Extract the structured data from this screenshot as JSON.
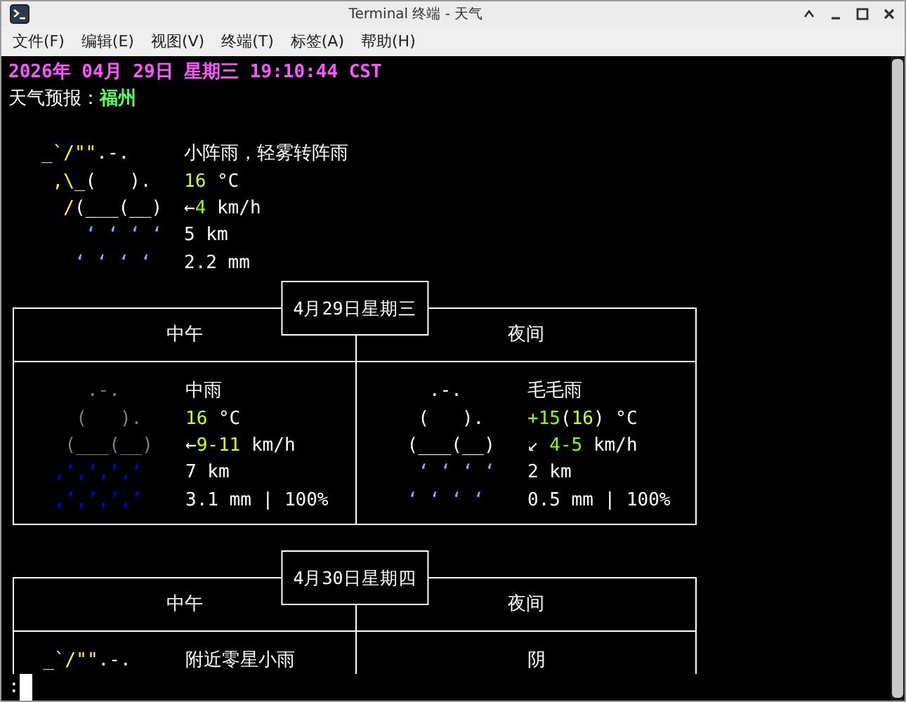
{
  "window": {
    "title": "Terminal 终端 - 天气"
  },
  "menu": [
    "文件(F)",
    "编辑(E)",
    "视图(V)",
    "终端(T)",
    "标签(A)",
    "帮助(H)"
  ],
  "terminal": {
    "header": {
      "bold": true,
      "segments": [
        {
          "text": "2026年 04月 29日 星期三 19:10:44 CST",
          "color": "#ff55ff"
        }
      ]
    },
    "title_line": [
      {
        "text": "天气预报：",
        "color": "#ffffff"
      },
      {
        "text": "福州",
        "color": "#55ff55"
      }
    ],
    "current": {
      "art": [
        [
          {
            "text": "   _`/\"\"",
            "color": "#ffff00"
          },
          {
            "text": ".-.",
            "color": "#ffffff"
          }
        ],
        [
          {
            "text": "    ,\\_",
            "color": "#ffff00"
          },
          {
            "text": "(   ).",
            "color": "#ffffff"
          }
        ],
        [
          {
            "text": "     /",
            "color": "#ffff00"
          },
          {
            "text": "(___(__)",
            "color": "#ffffff"
          }
        ],
        [
          {
            "text": "       ‘ ‘ ‘ ‘",
            "color": "#87afff"
          }
        ],
        [
          {
            "text": "      ‘ ‘ ‘ ‘",
            "color": "#87afff"
          }
        ]
      ],
      "info": [
        [
          {
            "text": "小阵雨，轻雾转阵雨",
            "color": "#ffffff"
          }
        ],
        [
          {
            "text": "16",
            "color": "#d7ff00"
          },
          {
            "text": " °C",
            "color": "#ffffff"
          }
        ],
        [
          {
            "text": "←",
            "color": "#ffffff"
          },
          {
            "text": "4",
            "color": "#87ff00"
          },
          {
            "text": " km/h",
            "color": "#ffffff"
          }
        ],
        [
          {
            "text": "5 km",
            "color": "#ffffff"
          }
        ],
        [
          {
            "text": "2.2 mm",
            "color": "#ffffff"
          }
        ]
      ]
    },
    "days": [
      {
        "date": "4月29日星期三",
        "periods": [
          {
            "label": "中午",
            "art": [
              [
                {
                  "text": "      .-.",
                  "color": "#808080"
                }
              ],
              [
                {
                  "text": "     (   ).",
                  "color": "#808080"
                }
              ],
              [
                {
                  "text": "    (___(__)",
                  "color": "#808080"
                }
              ],
              [
                {
                  "text": "   ‚‘‚‘‚‘‚‘",
                  "color": "#0000ff"
                }
              ],
              [
                {
                  "text": "   ‚’‚’‚’‚’",
                  "color": "#0000ff"
                }
              ]
            ],
            "info": [
              [
                {
                  "text": "中雨",
                  "color": "#ffffff"
                }
              ],
              [
                {
                  "text": "16",
                  "color": "#d7ff00"
                },
                {
                  "text": " °C",
                  "color": "#ffffff"
                }
              ],
              [
                {
                  "text": "←",
                  "color": "#ffffff"
                },
                {
                  "text": "9-11",
                  "color": "#d7ff00"
                },
                {
                  "text": " km/h",
                  "color": "#ffffff"
                }
              ],
              [
                {
                  "text": "7 km",
                  "color": "#ffffff"
                }
              ],
              [
                {
                  "text": "3.1 mm | 100%",
                  "color": "#ffffff"
                }
              ]
            ]
          },
          {
            "label": "夜间",
            "art": [
              [
                {
                  "text": "      .-.",
                  "color": "#ffffff"
                }
              ],
              [
                {
                  "text": "     (   ).",
                  "color": "#ffffff"
                }
              ],
              [
                {
                  "text": "    (___(__)",
                  "color": "#ffffff"
                }
              ],
              [
                {
                  "text": "     ‘ ‘ ‘ ‘",
                  "color": "#87afff"
                }
              ],
              [
                {
                  "text": "    ‘ ‘ ‘ ‘",
                  "color": "#87afff"
                }
              ]
            ],
            "info": [
              [
                {
                  "text": "毛毛雨",
                  "color": "#ffffff"
                }
              ],
              [
                {
                  "text": "+15",
                  "color": "#87ff00"
                },
                {
                  "text": "(",
                  "color": "#ffffff"
                },
                {
                  "text": "16",
                  "color": "#d7ff00"
                },
                {
                  "text": ") °C",
                  "color": "#ffffff"
                }
              ],
              [
                {
                  "text": "↙ ",
                  "color": "#ffffff"
                },
                {
                  "text": "4-5",
                  "color": "#87ff00"
                },
                {
                  "text": " km/h",
                  "color": "#ffffff"
                }
              ],
              [
                {
                  "text": "2 km",
                  "color": "#ffffff"
                }
              ],
              [
                {
                  "text": "0.5 mm | 100%",
                  "color": "#ffffff"
                }
              ]
            ]
          }
        ]
      },
      {
        "date": "4月30日星期四",
        "periods": [
          {
            "label": "中午",
            "art": [
              [
                {
                  "text": "  _`/\"\"",
                  "color": "#ffff00"
                },
                {
                  "text": ".-.",
                  "color": "#ffffff"
                }
              ]
            ],
            "info": [
              [
                {
                  "text": "附近零星小雨",
                  "color": "#ffffff"
                }
              ]
            ]
          },
          {
            "label": "夜间",
            "info": [
              [
                {
                  "text": "阴",
                  "color": "#ffffff"
                }
              ]
            ]
          }
        ]
      }
    ],
    "prompt": ":"
  }
}
